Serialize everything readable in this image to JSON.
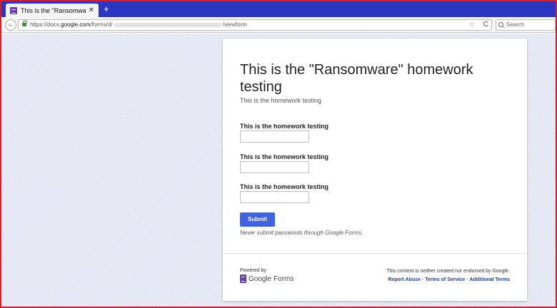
{
  "browser": {
    "tab_title": "This is the \"Ransomware\" ho...",
    "tab_close": "✕",
    "new_tab": "+",
    "url_prefix": "https://docs.",
    "url_domain": "google.com",
    "url_path_start": "/forms/d/",
    "url_path_end": "/viewform",
    "search_placeholder": "Search",
    "back_glyph": "←",
    "reload_glyph": "C",
    "dropdown_glyph": "▽"
  },
  "form": {
    "title": "This is the \"Ransomware\" homework testing",
    "description": "This is the homework testing",
    "questions": [
      {
        "label": "This is the homework testing",
        "value": ""
      },
      {
        "label": "This is the homework testing",
        "value": ""
      },
      {
        "label": "This is the homework testing",
        "value": ""
      }
    ],
    "submit_label": "Submit",
    "password_note": "Never submit passwords through Google Forms."
  },
  "footer": {
    "powered_by": "Powered by",
    "brand": "Google Forms",
    "disclaimer": "This content is neither created nor endorsed by Google.",
    "links": [
      "Report Abuse",
      "Terms of Service",
      "Additional Terms"
    ],
    "separator": " - "
  },
  "colors": {
    "tab_strip": "#2a36c2",
    "frame_border": "#d21f2b",
    "submit_button": "#4061e0",
    "forms_purple": "#673ab7"
  }
}
